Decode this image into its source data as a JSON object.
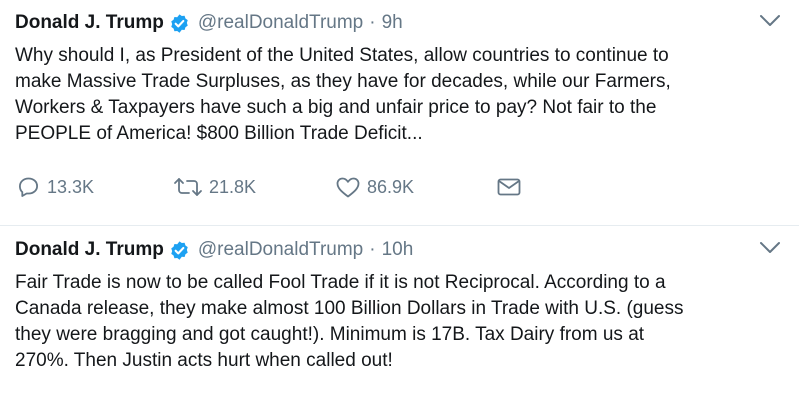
{
  "tweets": [
    {
      "name": "Donald J. Trump",
      "handle": "@realDonaldTrump",
      "separator": "·",
      "time": "9h",
      "text": "Why should I, as President of the United States, allow countries to continue to\nmake Massive Trade Surpluses, as they have for decades, while our Farmers,\nWorkers & Taxpayers have such a big and unfair price to pay? Not fair to the\nPEOPLE of America! $800 Billion Trade Deficit...",
      "replies": "13.3K",
      "retweets": "21.8K",
      "likes": "86.9K"
    },
    {
      "name": "Donald J. Trump",
      "handle": "@realDonaldTrump",
      "separator": "·",
      "time": "10h",
      "text": "Fair Trade is now to be called Fool Trade if it is not Reciprocal. According to a\nCanada release, they make almost 100 Billion Dollars in Trade with U.S. (guess\nthey were bragging and got caught!). Minimum is 17B. Tax Dairy from us at\n270%. Then Justin acts hurt when called out!"
    }
  ],
  "colors": {
    "verified_badge": "#1da1f2",
    "secondary_text": "#657786",
    "primary_text": "#14171a",
    "divider": "#e6ecf0"
  },
  "icons": [
    "verified-badge-icon",
    "chevron-down-icon",
    "reply-icon",
    "retweet-icon",
    "like-icon",
    "direct-message-icon"
  ]
}
